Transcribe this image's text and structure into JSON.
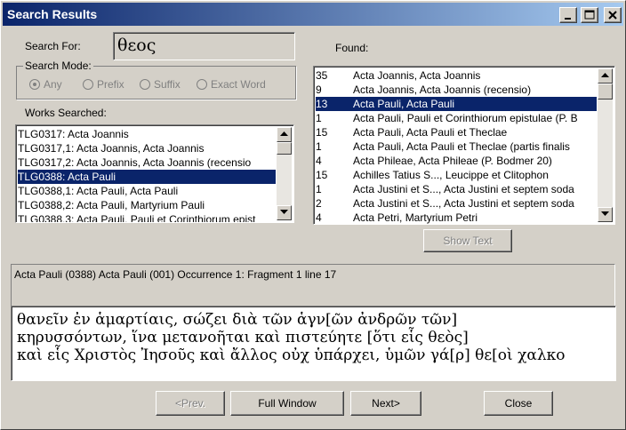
{
  "window": {
    "title": "Search Results"
  },
  "search": {
    "label": "Search For:",
    "value": "θεος"
  },
  "search_mode": {
    "label": "Search Mode:",
    "options": [
      {
        "label": "Any",
        "selected": true
      },
      {
        "label": "Prefix",
        "selected": false
      },
      {
        "label": "Suffix",
        "selected": false
      },
      {
        "label": "Exact Word",
        "selected": false
      }
    ]
  },
  "works": {
    "label": "Works Searched:",
    "items": [
      "TLG0317:  Acta Joannis",
      "TLG0317,1: Acta Joannis, Acta Joannis",
      "TLG0317,2: Acta Joannis, Acta Joannis (recensio",
      "TLG0388:  Acta Pauli",
      "TLG0388,1: Acta Pauli, Acta Pauli",
      "TLG0388,2: Acta Pauli, Martyrium Pauli",
      "TLG0388,3: Acta Pauli, Pauli et Corinthiorum epist"
    ],
    "selected_index": 3
  },
  "found": {
    "label": "Found:",
    "items": [
      {
        "count": "35",
        "title": "Acta Joannis, Acta Joannis"
      },
      {
        "count": "9",
        "title": "Acta Joannis, Acta Joannis (recensio)"
      },
      {
        "count": "13",
        "title": "Acta Pauli, Acta Pauli"
      },
      {
        "count": "1",
        "title": "Acta Pauli, Pauli et Corinthiorum epistulae (P. B"
      },
      {
        "count": "15",
        "title": "Acta Pauli, Acta Pauli et Theclae"
      },
      {
        "count": "1",
        "title": "Acta Pauli, Acta Pauli et Theclae (partis finalis"
      },
      {
        "count": "4",
        "title": "Acta Phileae, Acta Phileae (P. Bodmer 20)"
      },
      {
        "count": "15",
        "title": "Achilles Tatius S..., Leucippe et Clitophon"
      },
      {
        "count": "1",
        "title": "Acta Justini et S..., Acta Justini et septem soda"
      },
      {
        "count": "2",
        "title": "Acta Justini et S..., Acta Justini et septem soda"
      },
      {
        "count": "4",
        "title": "Acta Petri, Martyrium Petri"
      }
    ],
    "selected_index": 2
  },
  "show_text_label": "Show Text",
  "occurrence": {
    "header": "Acta Pauli (0388) Acta Pauli  (001) Occurrence 1: Fragment 1 line 17",
    "lines": [
      "θανεῖν ἐν ἁμαρτίαις, σώζει διὰ τῶν ἁγν[ῶν ἀνδρῶν τῶν]",
      "κηρυσσόντων, ἵνα μετανοῆται καὶ πιστεύητε [ὅτι εἷς θεὸς]",
      "καὶ εἷς Χριστὸς Ἰησοῦς καὶ ἄλλος οὐχ ὑπάρχει, ὑμῶν γά[ρ] θε[οὶ χαλκο"
    ]
  },
  "buttons": {
    "prev": "<Prev.",
    "full_window": "Full Window",
    "next": "Next>",
    "close": "Close"
  }
}
